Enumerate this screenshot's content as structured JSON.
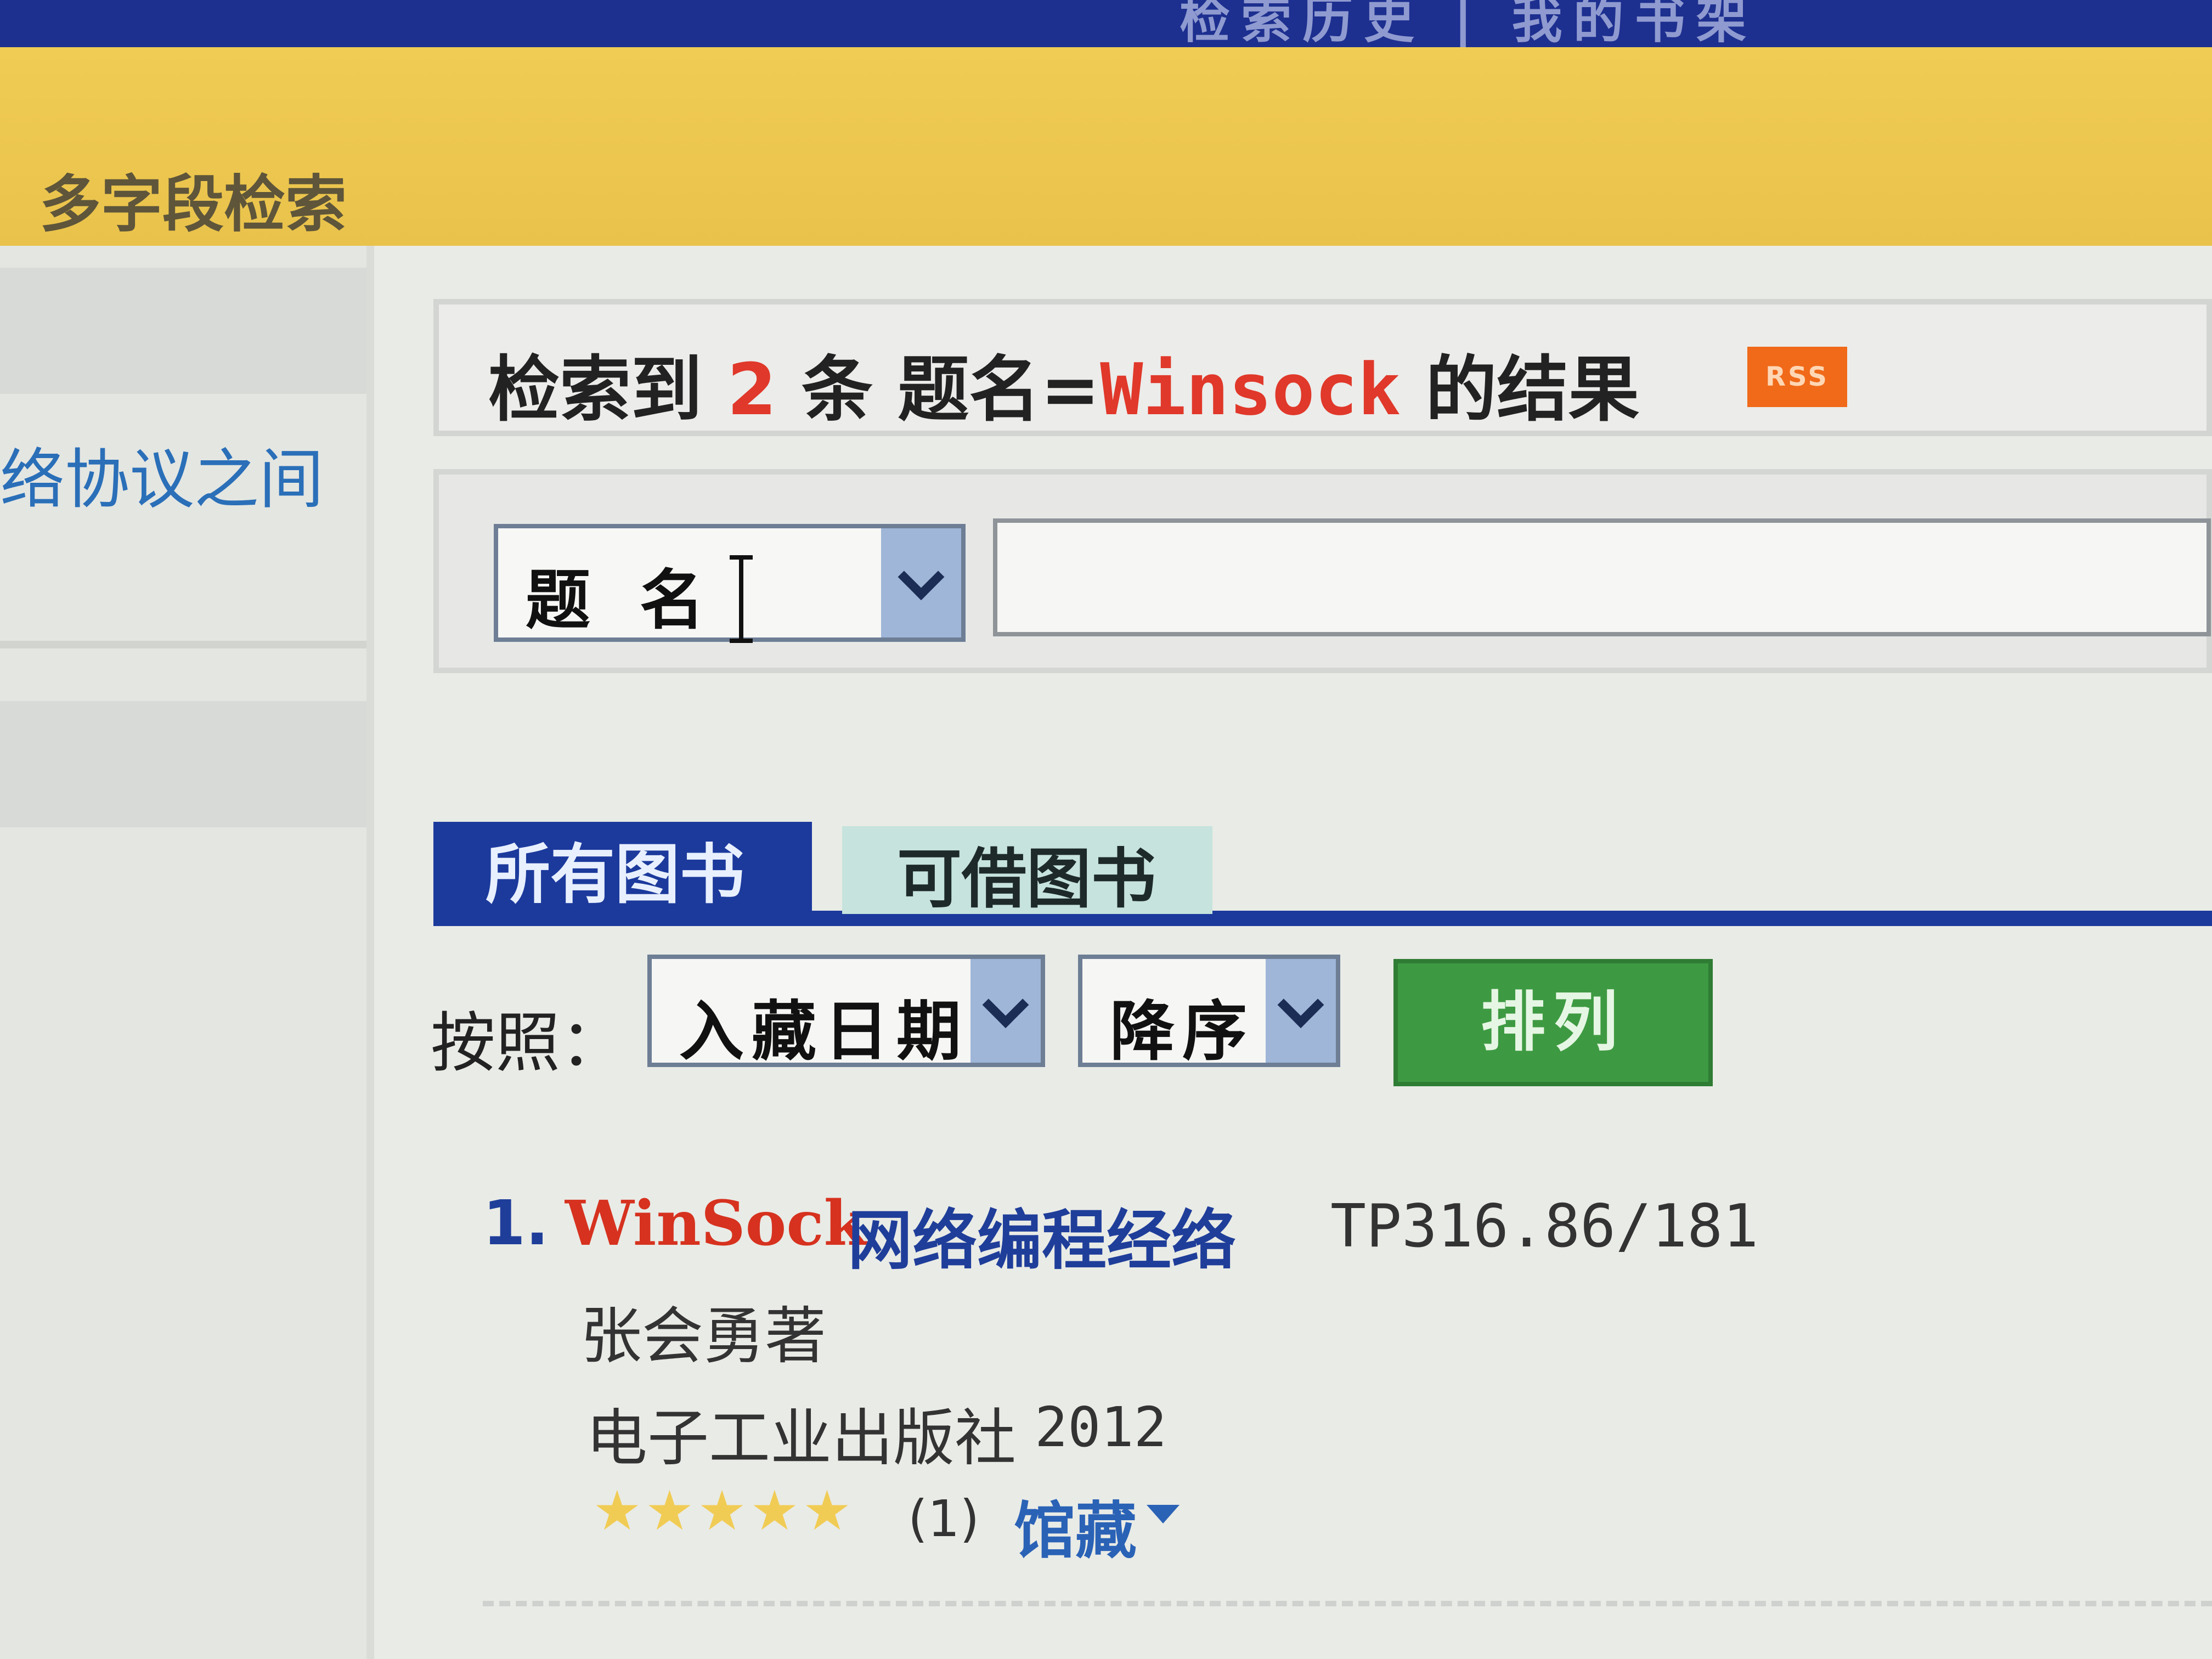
{
  "topbar": {
    "faint_nav": "检索历史  |  我的书架"
  },
  "header": {
    "title": "多字段检索"
  },
  "sidebar": {
    "link_fragment": "络协议之间"
  },
  "summary": {
    "prefix": "检索到",
    "count": "2",
    "unit": "条",
    "query_field": "题名=",
    "query_term": "Winsock",
    "suffix": "的结果",
    "rss_label": "RSS"
  },
  "search": {
    "field_selected": "题名",
    "input_value": ""
  },
  "tabs": [
    {
      "label": "所有图书",
      "active": true
    },
    {
      "label": "可借图书",
      "active": false
    }
  ],
  "sort": {
    "label": "按照：",
    "field_selected": "入藏日期",
    "order_selected": "降序",
    "button_label": "排列"
  },
  "results": [
    {
      "number": "1.",
      "title_highlight": "WinSock",
      "title_rest": "网络编程经络",
      "call_number": "TP316.86/181",
      "author": "张会勇著",
      "publisher": "电子工业出版社",
      "year": "2012",
      "stars": "★★★★★",
      "rating_count": "(1)",
      "holdings_label": "馆藏"
    }
  ],
  "colors": {
    "topbar": "#1d2f8f",
    "header": "#e9c24b",
    "highlight": "#d6321f",
    "link": "#1f3e9a",
    "tab_active": "#1c3a9c",
    "tab_inactive": "#c6e3dd",
    "sort_button": "#3e9a42",
    "rss": "#f06a1a"
  },
  "icons": [
    "chevron-down-icon",
    "rss-icon",
    "star-icon",
    "caret-down-icon",
    "text-cursor-icon"
  ]
}
